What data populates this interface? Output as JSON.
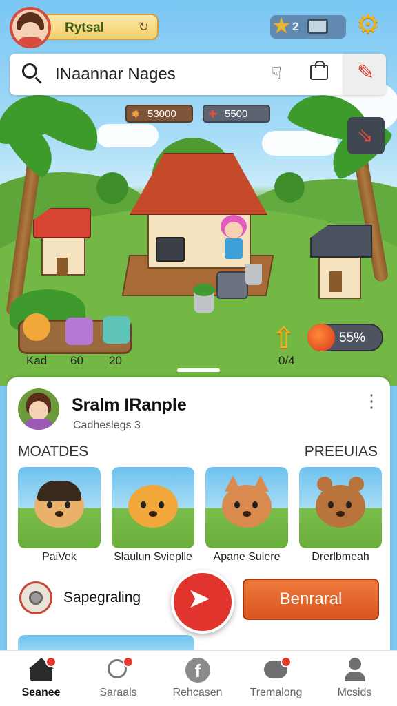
{
  "header": {
    "player_name": "Rytsal",
    "star_count": "2"
  },
  "search": {
    "query": "INaannar Nages"
  },
  "resources": {
    "wood": "53000",
    "gems": "5500"
  },
  "inventory": {
    "labels": [
      "Kad",
      "60",
      "20"
    ]
  },
  "stats": {
    "upgrade_label": "0/4",
    "percent": "55%"
  },
  "sheet": {
    "title": "Sralm IRanple",
    "subtitle": "Cadheslegs 3",
    "section_left": "MOATDES",
    "section_right": "PREEUIAS",
    "pets": [
      {
        "name": "PaiVek"
      },
      {
        "name": "Slaulun Svieplle"
      },
      {
        "name": "Apane Sulere"
      },
      {
        "name": "Drerlbmeah"
      }
    ],
    "ability_label": "Sapegraling",
    "primary_button": "Benraral"
  },
  "nav": {
    "items": [
      {
        "label": "Seanee",
        "icon": "home-icon",
        "active": true
      },
      {
        "label": "Saraals",
        "icon": "chat-icon"
      },
      {
        "label": "Rehcasen",
        "icon": "facebook-icon"
      },
      {
        "label": "Tremalong",
        "icon": "friends-icon"
      },
      {
        "label": "Mcsids",
        "icon": "profile-icon"
      }
    ]
  },
  "colors": {
    "accent": "#e0342c",
    "primary_button": "#e2652a",
    "gold": "#f2b21a"
  }
}
